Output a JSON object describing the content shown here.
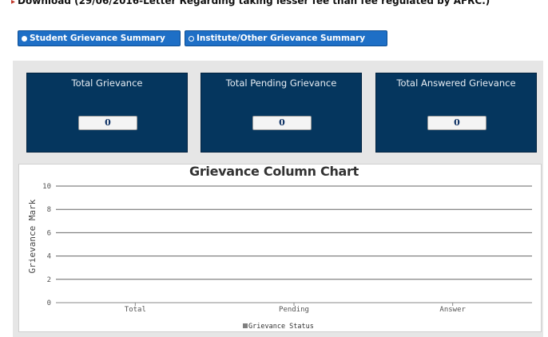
{
  "top_notice": {
    "text": "Download (29/06/2016-Letter Regarding taking lesser fee than fee regulated by AFRC.)",
    "arrow": "▸"
  },
  "tabs": [
    {
      "label": "Student Grievance Summary",
      "selected": true
    },
    {
      "label": "Institute/Other Grievance Summary",
      "selected": false
    }
  ],
  "cards": [
    {
      "title": "Total Grievance",
      "value": "0"
    },
    {
      "title": "Total Pending Grievance",
      "value": "0"
    },
    {
      "title": "Total Answered Grievance",
      "value": "0"
    }
  ],
  "colors": {
    "card_bg": "#05365e",
    "tab_bg": "#1e6fc6",
    "legend_swatch": "#808080"
  },
  "chart_data": {
    "type": "bar",
    "title": "Grievance Column Chart",
    "xlabel": "",
    "ylabel": "Grievance Mark",
    "categories": [
      "Total",
      "Pending",
      "Answer"
    ],
    "series": [
      {
        "name": "Grievance Status",
        "values": [
          0,
          0,
          0
        ]
      }
    ],
    "yticks": [
      "10",
      "8",
      "6",
      "4",
      "2",
      "0"
    ],
    "ylim": [
      0,
      10
    ],
    "grid": true,
    "legend": "bottom"
  }
}
